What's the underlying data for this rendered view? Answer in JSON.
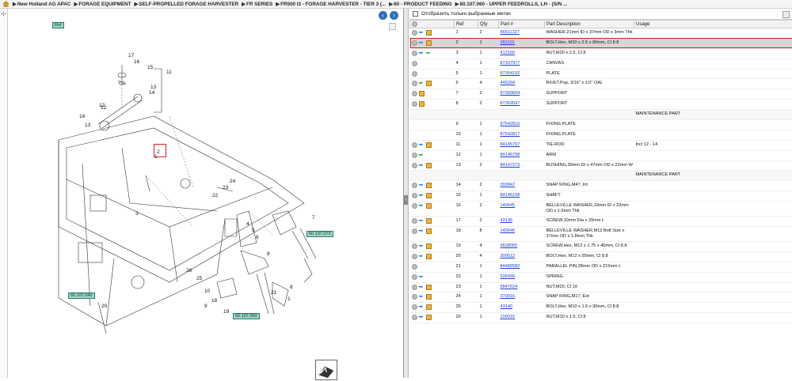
{
  "breadcrumb": [
    "New Holland AG APAC",
    "FORAGE EQUIPMENT",
    "SELF-PROPELLED FORAGE HARVESTER",
    "FR SERIES",
    "FR500 I3 - FORAGE HARVESTER - TIER 3 (...",
    "60 - PRODUCT FEEDING",
    "60.107.060 - UPPER FEEDROLLS, LH - (S/N ..."
  ],
  "parts_panel": {
    "filter_label": "Отобразить только выбранные метки",
    "columns": [
      "",
      "Ref",
      "Qty",
      "Part #",
      "Part Description",
      "Usage"
    ]
  },
  "callouts": {
    "top": "Ref",
    "c1": "60.107.070",
    "c2": "60.107.040",
    "c3": "60.107.060"
  },
  "rows": [
    {
      "ref": "1",
      "qty": "2",
      "part": "86511327",
      "desc": "WASHER,21mm ID x 37mm OD x 3mm Thk",
      "usage": "",
      "icons": [
        "info",
        "cart"
      ]
    },
    {
      "ref": "2",
      "qty": "1",
      "part": "382101",
      "desc": "BOLT,Hex, M20 x 2.5 x 80mm, Cl 8.8",
      "usage": "",
      "icons": [
        "info",
        "cart"
      ],
      "selected": true
    },
    {
      "ref": "3",
      "qty": "1",
      "part": "412160",
      "desc": "NUT,M20 x 2.5, Cl 8",
      "usage": "",
      "icons": [
        "info",
        "green"
      ]
    },
    {
      "ref": "4",
      "qty": "1",
      "part": "87337977",
      "desc": "CANVAS",
      "usage": "",
      "icons": []
    },
    {
      "ref": "5",
      "qty": "1",
      "part": "87354192",
      "desc": "PLATE",
      "usage": "",
      "icons": []
    },
    {
      "ref": "6",
      "qty": "4",
      "part": "445394",
      "desc": "RIVET,Pop, 3/16\" x 1/2\" OAL",
      "usage": "",
      "icons": [
        "green",
        "cart"
      ]
    },
    {
      "ref": "7",
      "qty": "2",
      "part": "87359604",
      "desc": "SUPPORT",
      "usage": "",
      "icons": [
        "cart"
      ]
    },
    {
      "ref": "8",
      "qty": "2",
      "part": "87359597",
      "desc": "SUPPORT",
      "usage": "",
      "icons": [
        "cart"
      ]
    },
    {
      "maint": "MAINTENANCE PART"
    },
    {
      "ref": "9",
      "qty": "1",
      "part": "87542816",
      "desc": "FIXING PLATE",
      "usage": "",
      "icons": [],
      "nocirc": true
    },
    {
      "ref": "10",
      "qty": "1",
      "part": "87542817",
      "desc": "FIXING PLATE",
      "usage": "",
      "icons": [],
      "nocirc": true
    },
    {
      "ref": "11",
      "qty": "1",
      "part": "84145797",
      "desc": "TIE-ROD",
      "usage": "Incl 12 - 14",
      "icons": [
        "info",
        "cart"
      ]
    },
    {
      "ref": "12",
      "qty": "1",
      "part": "84145798",
      "desc": "ARM",
      "usage": "",
      "icons": [
        "green"
      ]
    },
    {
      "ref": "13",
      "qty": "2",
      "part": "84147273",
      "desc": "BUSHING,30mm ID x 47mm OD x 22mm W",
      "usage": "",
      "icons": [
        "info",
        "cart"
      ]
    },
    {
      "maint": "MAINTENANCE PART"
    },
    {
      "ref": "14",
      "qty": "2",
      "part": "300847",
      "desc": "SNAP RING,M47, Int",
      "usage": "",
      "icons": [
        "info",
        "cart"
      ]
    },
    {
      "ref": "15",
      "qty": "1",
      "part": "84146158",
      "desc": "SHAFT",
      "usage": "",
      "icons": [
        "info",
        "cart"
      ]
    },
    {
      "ref": "16",
      "qty": "2",
      "part": "140045",
      "desc": "BELLEVILLE WASHER,10mm ID x 22mm OD x 1.6mm Thk",
      "usage": "",
      "icons": [
        "info",
        "cart"
      ],
      "tall": true
    },
    {
      "ref": "17",
      "qty": "2",
      "part": "43136",
      "desc": "SCREW,10mm Dia x 20mm L",
      "usage": "",
      "icons": [
        "info",
        "cart"
      ]
    },
    {
      "ref": "18",
      "qty": "8",
      "part": "140046",
      "desc": "BELLEVILLE WASHER,M12 Bolt Size x 27mm OD x 1.8mm Thk",
      "usage": "",
      "icons": [
        "info",
        "cart"
      ],
      "tall": true
    },
    {
      "ref": "19",
      "qty": "4",
      "part": "9628065",
      "desc": "SCREW,Hex, M12 x 1.75 x 45mm, Cl 8.8",
      "usage": "",
      "icons": [
        "info",
        "cart"
      ]
    },
    {
      "ref": "20",
      "qty": "4",
      "part": "300512",
      "desc": "BOLT,Hex, M12 x 55mm, Cl 8.8",
      "usage": "",
      "icons": [
        "info",
        "cart"
      ]
    },
    {
      "ref": "21",
      "qty": "1",
      "part": "84486582",
      "desc": "PARALLEL PIN,28mm OD x 215mm L",
      "usage": "",
      "icons": []
    },
    {
      "ref": "22",
      "qty": "1",
      "part": "536499",
      "desc": "SPRING",
      "usage": "",
      "icons": [
        "info"
      ]
    },
    {
      "ref": "23",
      "qty": "1",
      "part": "9847624",
      "desc": "NUT,M20, Cl 10",
      "usage": "",
      "icons": [
        "info",
        "cart"
      ]
    },
    {
      "ref": "24",
      "qty": "1",
      "part": "370016",
      "desc": "SNAP RING,M17, Ext",
      "usage": "",
      "icons": [
        "info",
        "cart"
      ]
    },
    {
      "ref": "25",
      "qty": "1",
      "part": "43140",
      "desc": "BOLT,Hex, M10 x 1.5 x 30mm, Cl 8.8",
      "usage": "",
      "icons": [
        "info",
        "cart"
      ]
    },
    {
      "ref": "26",
      "qty": "1",
      "part": "100016",
      "desc": "NUT,M10 x 1.5, Cl 8",
      "usage": "",
      "icons": [
        "info",
        "cart"
      ]
    }
  ],
  "diagram_labels": [
    "17",
    "16",
    "15",
    "11",
    "13",
    "14",
    "12",
    "14",
    "13",
    "2",
    "24",
    "23",
    "22",
    "3",
    "4",
    "5",
    "6",
    "7",
    "8",
    "26",
    "25",
    "10",
    "9",
    "18",
    "19",
    "20",
    "21",
    "8",
    "1",
    "1",
    "12"
  ]
}
